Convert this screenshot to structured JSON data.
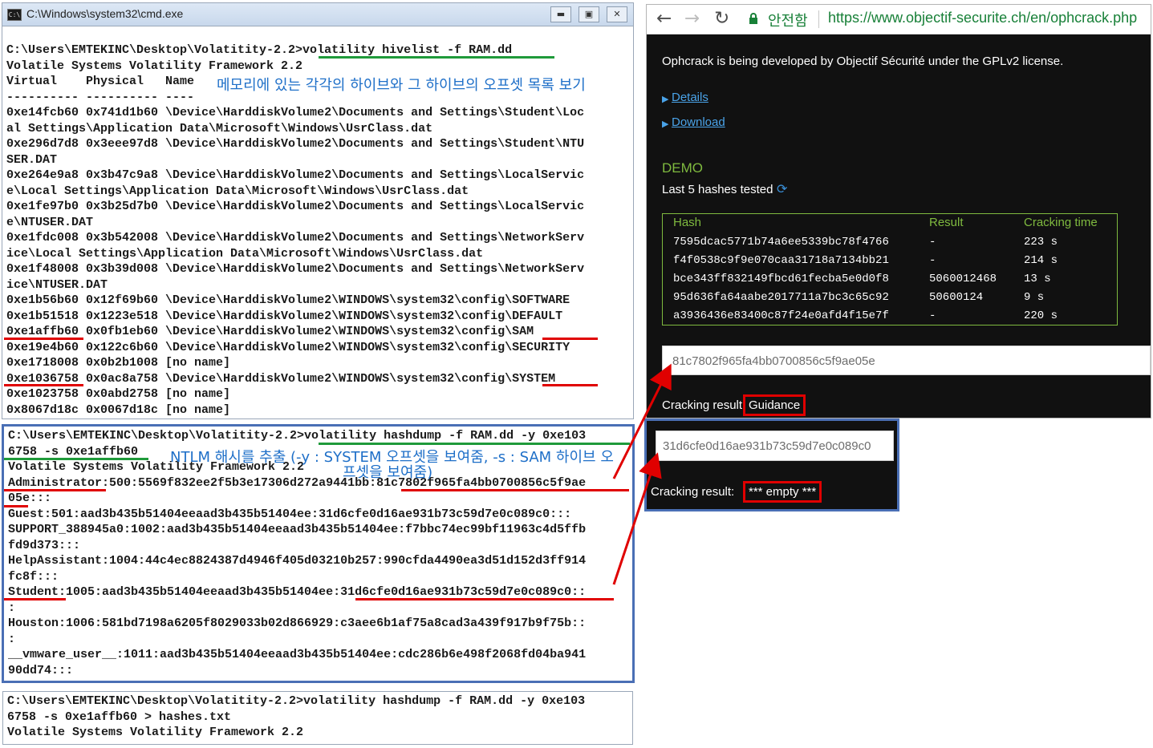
{
  "cmd_window": {
    "title": "C:\\Windows\\system32\\cmd.exe",
    "buttons": {
      "minimize": "▬",
      "maximize": "▣",
      "close": "✕"
    }
  },
  "hivelist_console": {
    "lines": [
      "C:\\Users\\EMTEKINC\\Desktop\\Volatitity-2.2>volatility hivelist -f RAM.dd",
      "Volatile Systems Volatility Framework 2.2",
      "Virtual    Physical   Name",
      "---------- ---------- ----",
      "0xe14fcb60 0x741d1b60 \\Device\\HarddiskVolume2\\Documents and Settings\\Student\\Loc",
      "al Settings\\Application Data\\Microsoft\\Windows\\UsrClass.dat",
      "0xe296d7d8 0x3eee97d8 \\Device\\HarddiskVolume2\\Documents and Settings\\Student\\NTU",
      "SER.DAT",
      "0xe264e9a8 0x3b47c9a8 \\Device\\HarddiskVolume2\\Documents and Settings\\LocalServic",
      "e\\Local Settings\\Application Data\\Microsoft\\Windows\\UsrClass.dat",
      "0xe1fe97b0 0x3b25d7b0 \\Device\\HarddiskVolume2\\Documents and Settings\\LocalServic",
      "e\\NTUSER.DAT",
      "0xe1fdc008 0x3b542008 \\Device\\HarddiskVolume2\\Documents and Settings\\NetworkServ",
      "ice\\Local Settings\\Application Data\\Microsoft\\Windows\\UsrClass.dat",
      "0xe1f48008 0x3b39d008 \\Device\\HarddiskVolume2\\Documents and Settings\\NetworkServ",
      "ice\\NTUSER.DAT",
      "0xe1b56b60 0x12f69b60 \\Device\\HarddiskVolume2\\WINDOWS\\system32\\config\\SOFTWARE",
      "0xe1b51518 0x1223e518 \\Device\\HarddiskVolume2\\WINDOWS\\system32\\config\\DEFAULT",
      "0xe1affb60 0x0fb1eb60 \\Device\\HarddiskVolume2\\WINDOWS\\system32\\config\\SAM",
      "0xe19e4b60 0x122c6b60 \\Device\\HarddiskVolume2\\WINDOWS\\system32\\config\\SECURITY",
      "0xe1718008 0x0b2b1008 [no name]",
      "0xe1036758 0x0ac8a758 \\Device\\HarddiskVolume2\\WINDOWS\\system32\\config\\SYSTEM",
      "0xe1023758 0x0abd2758 [no name]",
      "0x8067d18c 0x0067d18c [no name]"
    ],
    "annotation": "메모리에 있는 각각의 하이브와 그 하이브의 오프셋 목록 보기"
  },
  "hashdump_console": {
    "lines": [
      "C:\\Users\\EMTEKINC\\Desktop\\Volatitity-2.2>volatility hashdump -f RAM.dd -y 0xe103",
      "6758 -s 0xe1affb60",
      "Volatile Systems Volatility Framework 2.2",
      "Administrator:500:5569f832ee2f5b3e17306d272a9441bb:81c7802f965fa4bb0700856c5f9ae",
      "05e:::",
      "Guest:501:aad3b435b51404eeaad3b435b51404ee:31d6cfe0d16ae931b73c59d7e0c089c0:::",
      "SUPPORT_388945a0:1002:aad3b435b51404eeaad3b435b51404ee:f7bbc74ec99bf11963c4d5ffb",
      "fd9d373:::",
      "HelpAssistant:1004:44c4ec8824387d4946f405d03210b257:990cfda4490ea3d51d152d3ff914",
      "fc8f:::",
      "Student:1005:aad3b435b51404eeaad3b435b51404ee:31d6cfe0d16ae931b73c59d7e0c089c0::",
      ":",
      "Houston:1006:581bd7198a6205f8029033b02d866929:c3aee6b1af75a8cad3a439f917b9f75b::",
      ":",
      "__vmware_user__:1011:aad3b435b51404eeaad3b435b51404ee:cdc286b6e498f2068fd04ba941",
      "90dd74:::"
    ],
    "annotation_line1": "NTLM 해시를 추출 (-y : SYSTEM 오프셋을 보여줌, -s : SAM 하이브 오",
    "annotation_line2": "프셋을 보여줌)"
  },
  "save_console": {
    "lines": [
      "C:\\Users\\EMTEKINC\\Desktop\\Volatitity-2.2>volatility hashdump -f RAM.dd -y 0xe103",
      "6758 -s 0xe1affb60 > hashes.txt",
      "Volatile Systems Volatility Framework 2.2"
    ]
  },
  "browser": {
    "nav": {
      "back": "←",
      "forward": "→",
      "reload": "↻"
    },
    "secure_label": "안전함",
    "url": "https://www.objectif-securite.ch/en/ophcrack.php",
    "intro": "Ophcrack is being developed by Objectif Sécurité under the GPLv2 license.",
    "links": [
      "Details",
      "Download"
    ],
    "demo_heading": "DEMO",
    "last_tested": "Last 5 hashes tested",
    "table": {
      "headers": [
        "Hash",
        "Result",
        "Cracking time"
      ],
      "rows": [
        [
          "7595dcac5771b74a6ee5339bc78f4766",
          "-",
          "223 s"
        ],
        [
          "f4f0538c9f9e070caa31718a7134bb21",
          "-",
          "214 s"
        ],
        [
          "bce343ff832149fbcd61fecba5e0d0f8",
          "5060012468",
          "13 s"
        ],
        [
          "95d636fa64aabe2017711a7bc3c65c92",
          "50600124",
          "9 s"
        ],
        [
          "a3936436e83400c87f24e0afd4f15e7f",
          "-",
          "220 s"
        ]
      ]
    },
    "input_value": "81c7802f965fa4bb0700856c5f9ae05e",
    "result_label": "Cracking result:",
    "result_value": "Guidance"
  },
  "second_panel": {
    "input_value": "31d6cfe0d16ae931b73c59d7e0c089c0",
    "result_label": "Cracking result:",
    "result_value": "*** empty ***"
  },
  "colors": {
    "red_marker": "#e00000",
    "green_marker": "#1f9a3a",
    "blue_box": "#4a6fb5",
    "annotation_text": "#1e6fc8",
    "ophcrack_green": "#7fba3f"
  }
}
